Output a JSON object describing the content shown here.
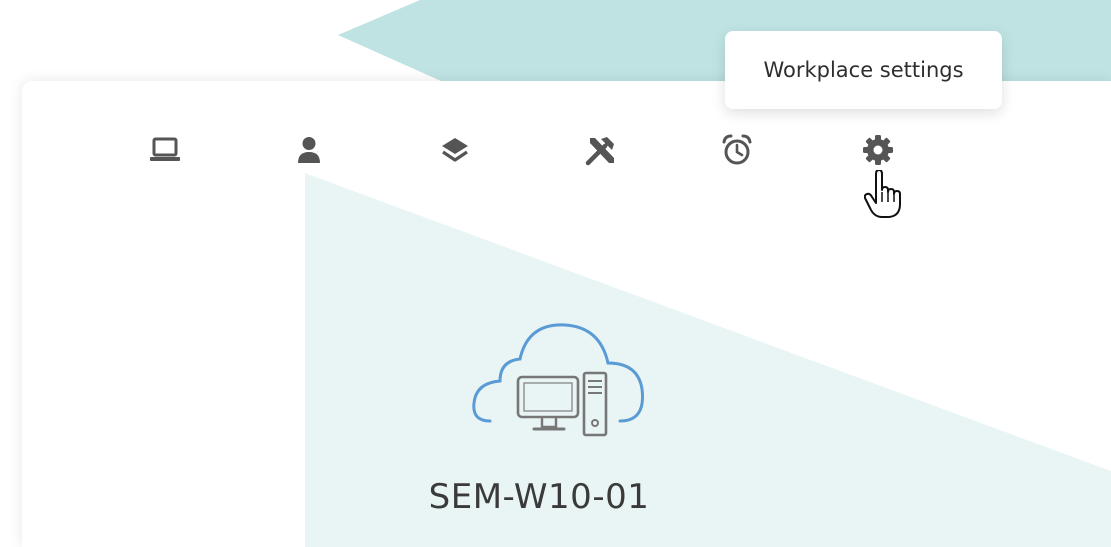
{
  "toolbar": {
    "items": [
      {
        "icon": "laptop-icon"
      },
      {
        "icon": "user-icon"
      },
      {
        "icon": "layers-icon"
      },
      {
        "icon": "tools-icon"
      },
      {
        "icon": "alarm-clock-icon"
      },
      {
        "icon": "gear-icon"
      }
    ],
    "icon_color": "#555555"
  },
  "tooltip": {
    "text": "Workplace settings"
  },
  "workplace": {
    "icon": "cloud-computer-icon",
    "name": "SEM-W10-01",
    "icon_color": "#5b9bd5"
  },
  "colors": {
    "accent_teal": "#bfe3e3",
    "accent_teal_light": "#e9f5f5"
  }
}
